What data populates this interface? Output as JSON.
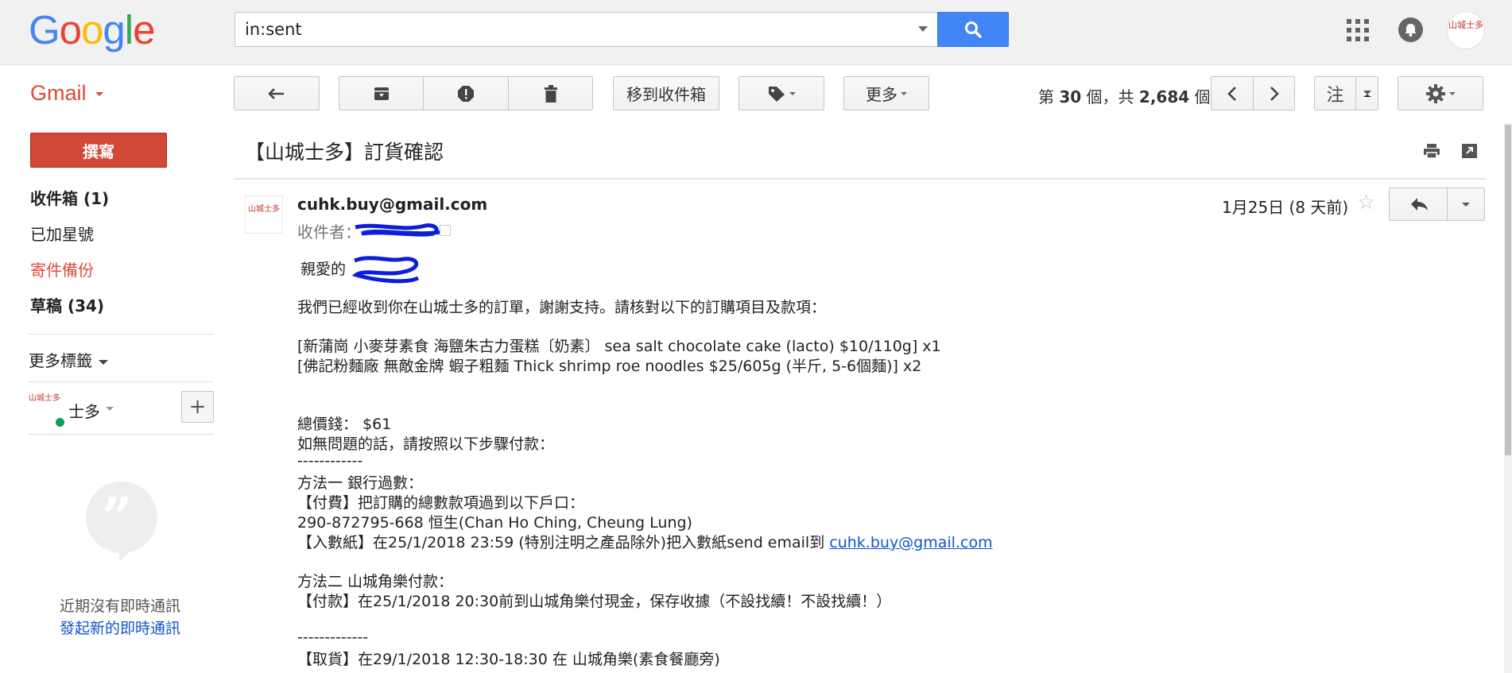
{
  "header": {
    "logo_letters": [
      {
        "ch": "G",
        "color": "#4285f4"
      },
      {
        "ch": "o",
        "color": "#ea4335"
      },
      {
        "ch": "o",
        "color": "#fbbc05"
      },
      {
        "ch": "g",
        "color": "#4285f4"
      },
      {
        "ch": "l",
        "color": "#34a853"
      },
      {
        "ch": "e",
        "color": "#ea4335"
      }
    ],
    "search_value": "in:sent",
    "avatar_text": "山城士多"
  },
  "toolbar": {
    "gmail_label": "Gmail",
    "move_to_inbox": "移到收件箱",
    "more": "更多",
    "counter_prefix": "第 ",
    "counter_current": "30",
    "counter_mid": " 個，共 ",
    "counter_total": "2,684",
    "counter_suffix": " 個",
    "input_tools_label": "注"
  },
  "sidebar": {
    "compose": "撰寫",
    "items": [
      {
        "label": "收件箱 (1)"
      },
      {
        "label": "已加星號"
      },
      {
        "label": "寄件備份"
      },
      {
        "label": "草稿 (34)"
      }
    ],
    "more_labels": "更多標籤",
    "hangout_avatar_text": "山城士多",
    "hangout_name": "士多",
    "plus": "+",
    "no_chats": "近期沒有即時通訊",
    "start_chat": "發起新的即時通訊"
  },
  "message": {
    "subject": "【山城士多】訂貨確認",
    "sender_avatar_text": "山城士多",
    "sender": "cuhk.buy@gmail.com",
    "to_label": "收件者：",
    "date": "1月25日 (8 天前)",
    "star": "☆",
    "greeting": "親愛的",
    "lines": [
      "我們已經收到你在山城士多的訂單，謝謝支持。請核對以下的訂購項目及款項：",
      "[新蒲崗 小麥芽素食 海鹽朱古力蛋糕〔奶素〕 sea salt chocolate cake (lacto) $10/110g] x1",
      "[佛記粉麵廠 無敵金牌 蝦子粗麵 Thick shrimp roe noodles $25/605g (半斤, 5-6個麵)] x2",
      "總價錢： $61",
      "如無問題的話，請按照以下步驟付款：",
      "------------",
      "方法一 銀行過數：",
      "【付費】把訂購的總數款項過到以下戶口：",
      "290-872795-668 恒生(Chan Ho Ching, Cheung Lung)",
      "【入數紙】在25/1/2018 23:59 (特別注明之產品除外)把入數紙send email到 ",
      "方法二 山城角樂付款：",
      "【付款】在25/1/2018 20:30前到山城角樂付現金，保存收據（不設找續！不設找續！）",
      " -------------",
      "【取貨】在29/1/2018 12:30-18:30  在 山城角樂(素食餐廳旁)"
    ],
    "email_link": "cuhk.buy@gmail.com"
  },
  "colors": {
    "accent_red": "#dd4b39",
    "compose_red": "#d14836",
    "search_blue": "#4285f4",
    "link_blue": "#1155cc",
    "online_green": "#0f9d58",
    "scribble_blue": "#0b1fd8"
  },
  "icons": [
    "search-icon",
    "apps-grid-icon",
    "notifications-icon",
    "reply-icon",
    "archive-icon",
    "report-spam-icon",
    "delete-icon",
    "label-icon",
    "chevron-left-icon",
    "chevron-right-icon",
    "settings-gear-icon",
    "print-icon",
    "new-window-icon",
    "star-icon",
    "quote-bubble-icon"
  ]
}
